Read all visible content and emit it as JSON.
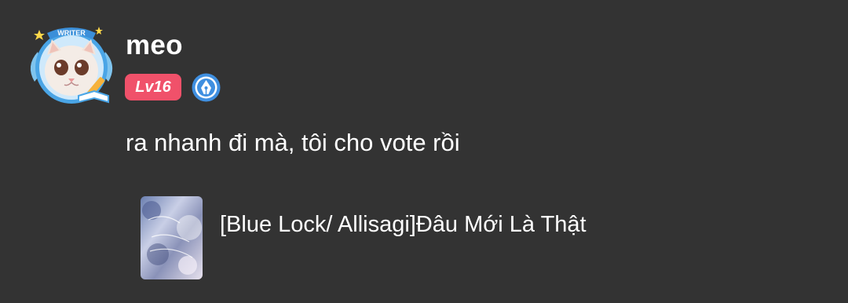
{
  "comment": {
    "username": "meo",
    "level_label": "Lv16",
    "avatar_frame_label": "WRITER",
    "text": "ra nhanh đi mà, tôi cho vote rồi"
  },
  "story": {
    "title": "[Blue Lock/ Allisagi]Đâu Mới Là Thật"
  },
  "icons": {
    "avatar": "cat-avatar-icon",
    "writer_badge": "pen-nib-badge-icon"
  },
  "colors": {
    "background": "#333333",
    "level_badge": "#f0516a",
    "writer_badge": "#3f8fe0",
    "text": "#ffffff"
  }
}
